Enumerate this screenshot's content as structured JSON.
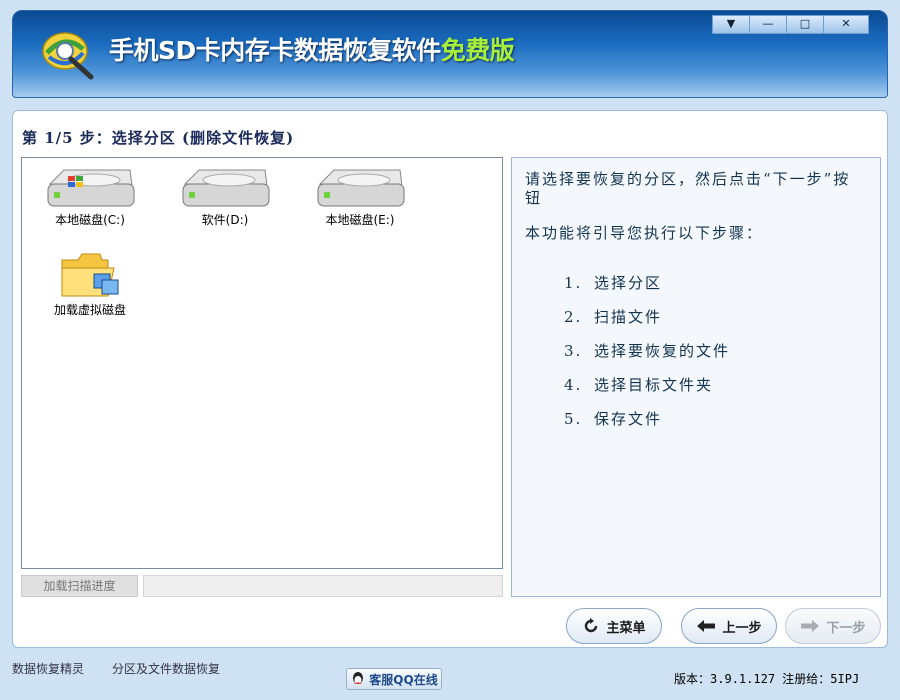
{
  "window": {
    "title_main": "手机SD卡内存卡数据恢复软件",
    "title_free": "免费版",
    "controls": {
      "menu": "▼",
      "minimize": "—",
      "maximize": "□",
      "close": "✕"
    }
  },
  "step_title": "第 1/5 步：选择分区 (删除文件恢复)",
  "drives": [
    {
      "label": "本地磁盘(C:)",
      "icon": "windows-drive-icon"
    },
    {
      "label": "软件(D:)",
      "icon": "hard-drive-icon"
    },
    {
      "label": "本地磁盘(E:)",
      "icon": "hard-drive-icon"
    },
    {
      "label": "加载虚拟磁盘",
      "icon": "folder-icon"
    }
  ],
  "instructions": {
    "intro": "请选择要恢复的分区，然后点击“下一步”按钮",
    "guide": "本功能将引导您执行以下步骤：",
    "steps": [
      {
        "num": "1.",
        "text": "选择分区"
      },
      {
        "num": "2.",
        "text": "扫描文件"
      },
      {
        "num": "3.",
        "text": "选择要恢复的文件"
      },
      {
        "num": "4.",
        "text": "选择目标文件夹"
      },
      {
        "num": "5.",
        "text": "保存文件"
      }
    ]
  },
  "progress": {
    "button_label": "加载扫描进度",
    "value": 0
  },
  "buttons": {
    "main_menu": "主菜单",
    "prev": "上一步",
    "next": "下一步"
  },
  "status": {
    "left1": "数据恢复精灵",
    "left2": "分区及文件数据恢复",
    "qq": "客服QQ在线",
    "version_label": "版本：",
    "version": "3.9.1.127",
    "reg_label": "注册给：",
    "reg": "5IPJ"
  },
  "colors": {
    "header_dark": "#0a4a93",
    "free_text": "#a8ef3a",
    "accent": "#1a6cc0"
  }
}
